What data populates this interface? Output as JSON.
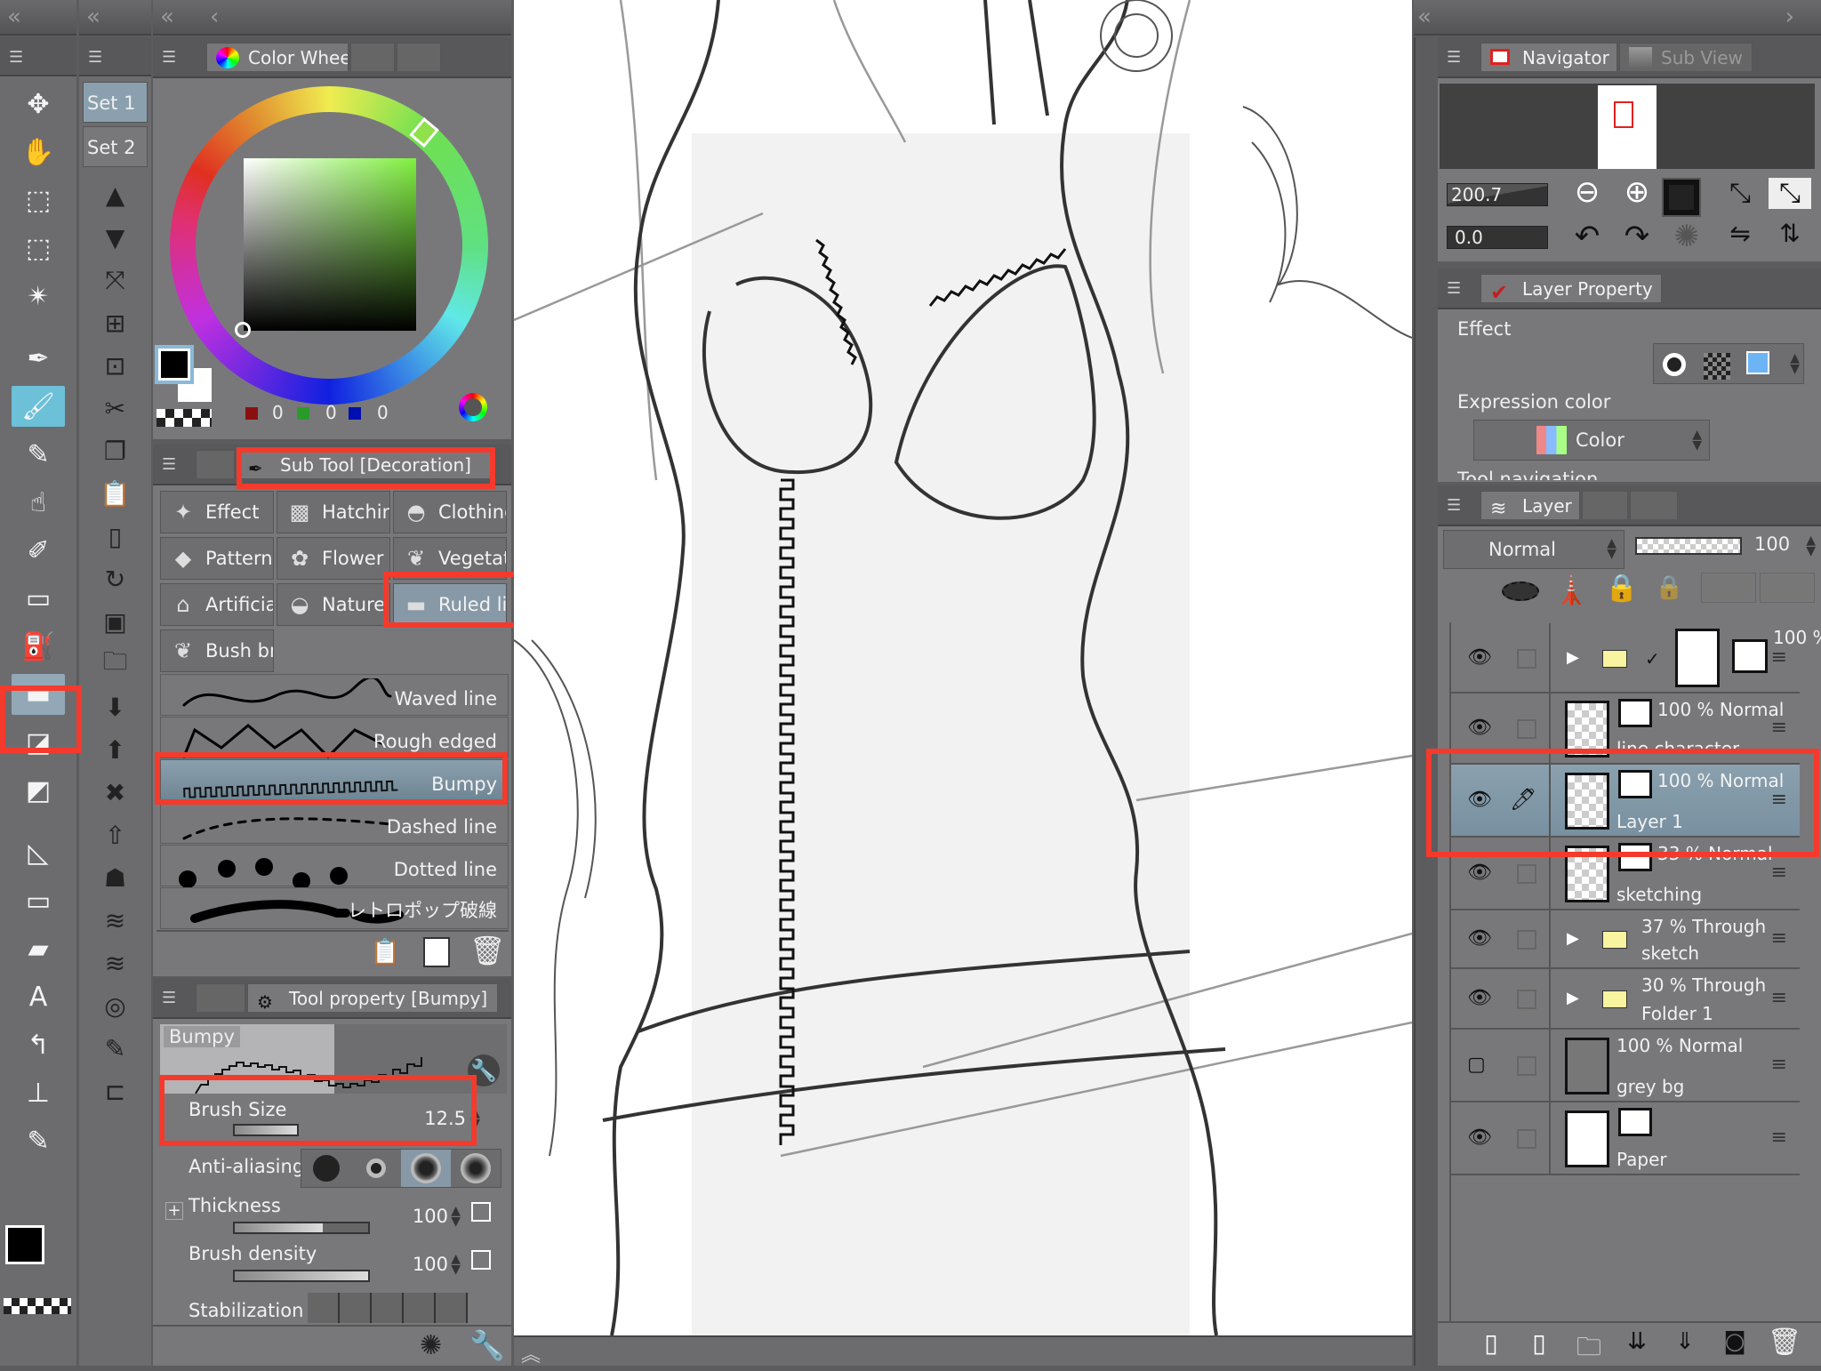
{
  "colors": {
    "accent": "#f43a2c",
    "selected": "#8799a7",
    "panel": "#78787b",
    "highlight_box": "#f43a2c"
  },
  "toolbar_left": {
    "icons": [
      "move-icon",
      "hand-icon",
      "object-select-icon",
      "selection-marquee-icon",
      "magic-wand-icon",
      "pen-icon",
      "brush-icon",
      "airbrush-icon",
      "blend-icon",
      "eraser-tip-icon",
      "eraser-icon",
      "fill-bucket-icon",
      "decoration-ruled-icon",
      "eraser2-icon",
      "gradient-icon",
      "ruler-icon",
      "rectangle-icon",
      "frame-icon",
      "text-icon",
      "balloon-icon",
      "eyedropper-icon",
      "pipette-icon"
    ]
  },
  "toolbar_set": {
    "set1": "Set 1",
    "set2": "Set 2"
  },
  "color_wheel": {
    "tab": "Color Wheel",
    "r": "0",
    "g": "0",
    "b": "0",
    "main_color": "#000000",
    "sub_color": "#ffffff",
    "hue_marker_color": "#8fe04a"
  },
  "sub_tool": {
    "tab": "Sub Tool [Decoration]",
    "groups": [
      {
        "label": "Effect",
        "icon": "sparkle-icon"
      },
      {
        "label": "Hatching",
        "icon": "hatching-icon"
      },
      {
        "label": "Clothing",
        "icon": "hat-icon"
      },
      {
        "label": "Pattern",
        "icon": "pattern-icon"
      },
      {
        "label": "Flower",
        "icon": "flower-icon"
      },
      {
        "label": "Vegetation",
        "icon": "vegetation-icon"
      },
      {
        "label": "Artificial",
        "icon": "house-icon"
      },
      {
        "label": "Nature",
        "icon": "rock-icon"
      },
      {
        "label": "Ruled line",
        "icon": "ruled-line-icon",
        "selected": true
      },
      {
        "label": "Bush brush",
        "icon": "bush-icon"
      }
    ],
    "brushes": [
      {
        "label": "Waved line"
      },
      {
        "label": "Rough edged"
      },
      {
        "label": "Bumpy",
        "selected": true
      },
      {
        "label": "Dashed line"
      },
      {
        "label": "Dotted line"
      },
      {
        "label": "レトロポップ破線"
      }
    ]
  },
  "tool_property": {
    "tab": "Tool property [Bumpy]",
    "preview_label": "Bumpy",
    "brush_size": {
      "label": "Brush Size",
      "value": "12.5",
      "fill": 0.3
    },
    "anti_aliasing": {
      "label": "Anti-aliasing",
      "selected_index": 2
    },
    "thickness": {
      "label": "Thickness",
      "value": "100",
      "fill": 0.66
    },
    "brush_density": {
      "label": "Brush density",
      "value": "100",
      "fill": 1.0
    },
    "stabilization": {
      "label": "Stabilization"
    }
  },
  "navigator": {
    "tab": "Navigator",
    "tab2": "Sub View",
    "zoom": "200.7",
    "rotation": "0.0"
  },
  "layer_property": {
    "tab": "Layer Property",
    "effect_label": "Effect",
    "expression_label": "Expression color",
    "expression_value": "Color",
    "cut_label": "Tool navigation"
  },
  "layer_panel": {
    "tab": "Layer",
    "blend_mode": "Normal",
    "opacity": "100",
    "layers": [
      {
        "line1": "100 %",
        "line2": "",
        "type": "folder",
        "visible": true
      },
      {
        "line1": "100 % Normal",
        "line2": "line character",
        "type": "raster",
        "visible": true
      },
      {
        "line1": "100 % Normal",
        "line2": "Layer 1",
        "type": "raster",
        "visible": true,
        "selected": true
      },
      {
        "line1": "33 % Normal",
        "line2": "sketching",
        "type": "raster",
        "visible": true
      },
      {
        "line1": "37 % Through",
        "line2": "sketch",
        "type": "folder",
        "visible": true
      },
      {
        "line1": "30 % Through",
        "line2": "Folder 1",
        "type": "folder",
        "visible": true
      },
      {
        "line1": "100 % Normal",
        "line2": "grey bg",
        "type": "fill",
        "visible": false
      },
      {
        "line1": "",
        "line2": "Paper",
        "type": "paper",
        "visible": true
      }
    ]
  }
}
